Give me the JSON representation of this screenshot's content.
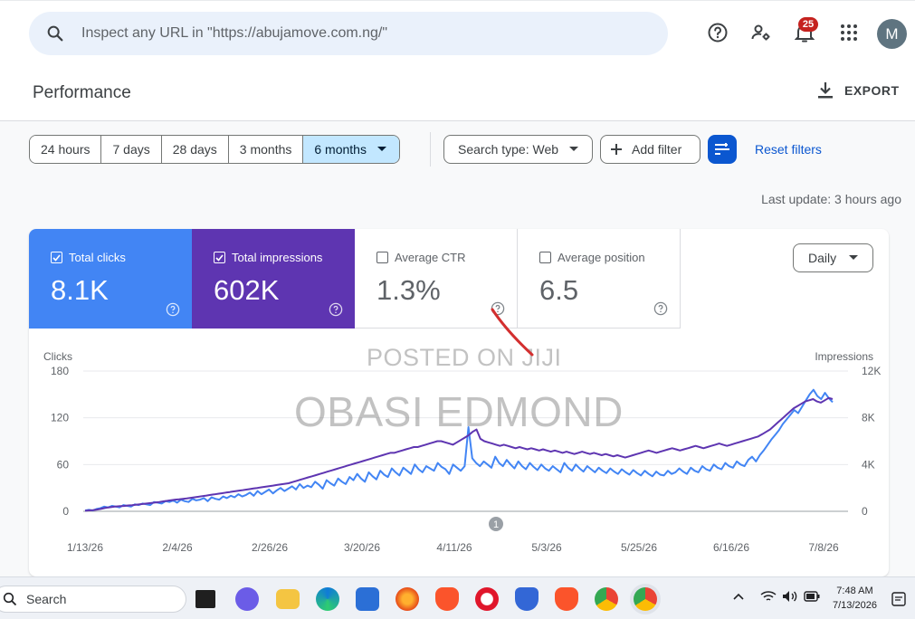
{
  "search": {
    "placeholder": "Inspect any URL in \"https://abujamove.com.ng/\""
  },
  "header": {
    "notification_count": "25",
    "avatar_letter": "M"
  },
  "page": {
    "title": "Performance",
    "export_label": "EXPORT"
  },
  "filters": {
    "date_ranges": [
      "24 hours",
      "7 days",
      "28 days",
      "3 months",
      "6 months"
    ],
    "active_range": "6 months",
    "search_type": "Search type: Web",
    "add_filter": "Add filter",
    "reset": "Reset filters",
    "last_update": "Last update: 3 hours ago"
  },
  "metrics": {
    "clicks": {
      "label": "Total clicks",
      "value": "8.1K",
      "checked": true
    },
    "impressions": {
      "label": "Total impressions",
      "value": "602K",
      "checked": true
    },
    "ctr": {
      "label": "Average CTR",
      "value": "1.3%",
      "checked": false
    },
    "position": {
      "label": "Average position",
      "value": "6.5",
      "checked": false
    }
  },
  "granularity": "Daily",
  "watermark": {
    "line1": "POSTED ON JIJI",
    "line2": "OBASI EDMOND"
  },
  "colors": {
    "clicks": "#4285f4",
    "impressions": "#5e35b1",
    "accent": "#0b57d0"
  },
  "chart_data": {
    "type": "line",
    "ylabel_left": "Clicks",
    "ylabel_right": "Impressions",
    "y_left_ticks": [
      "180",
      "120",
      "60",
      "0"
    ],
    "y_right_ticks": [
      "12K",
      "8K",
      "4K",
      "0"
    ],
    "y_left_range": [
      0,
      180
    ],
    "y_right_range": [
      0,
      12000
    ],
    "x_ticks": [
      "1/13/26",
      "2/4/26",
      "2/26/26",
      "3/20/26",
      "4/11/26",
      "5/3/26",
      "5/25/26",
      "6/16/26",
      "7/8/26"
    ],
    "annotation": "1",
    "grid": true,
    "series": [
      {
        "name": "Clicks",
        "axis": "left",
        "values": [
          1,
          2,
          1,
          3,
          4,
          6,
          5,
          7,
          6,
          5,
          8,
          7,
          6,
          9,
          8,
          10,
          9,
          8,
          12,
          11,
          10,
          13,
          12,
          14,
          11,
          15,
          13,
          12,
          16,
          14,
          15,
          17,
          13,
          18,
          16,
          15,
          19,
          17,
          20,
          18,
          22,
          19,
          21,
          24,
          20,
          26,
          22,
          25,
          28,
          23,
          27,
          30,
          26,
          29,
          32,
          28,
          35,
          30,
          33,
          31,
          38,
          34,
          29,
          40,
          36,
          33,
          42,
          38,
          35,
          44,
          40,
          48,
          42,
          38,
          50,
          45,
          41,
          52,
          47,
          44,
          55,
          50,
          46,
          56,
          52,
          48,
          60,
          54,
          50,
          58,
          55,
          52,
          62,
          57,
          54,
          48,
          60,
          56,
          52,
          58,
          108,
          68,
          62,
          58,
          64,
          60,
          56,
          70,
          62,
          58,
          66,
          60,
          55,
          64,
          58,
          54,
          62,
          57,
          53,
          60,
          55,
          52,
          58,
          54,
          50,
          62,
          56,
          52,
          60,
          55,
          51,
          58,
          54,
          50,
          56,
          52,
          49,
          55,
          51,
          48,
          54,
          50,
          47,
          53,
          49,
          46,
          52,
          48,
          45,
          51,
          47,
          46,
          52,
          48,
          50,
          55,
          51,
          48,
          56,
          52,
          50,
          58,
          54,
          52,
          60,
          56,
          54,
          62,
          58,
          56,
          64,
          60,
          58,
          66,
          70,
          64,
          72,
          78,
          85,
          92,
          98,
          104,
          112,
          118,
          124,
          130,
          126,
          134,
          142,
          150,
          156,
          148,
          144,
          152,
          145,
          140
        ]
      },
      {
        "name": "Impressions",
        "axis": "right",
        "values": [
          50,
          80,
          100,
          150,
          200,
          280,
          330,
          380,
          420,
          440,
          460,
          500,
          520,
          560,
          600,
          640,
          680,
          720,
          760,
          800,
          850,
          900,
          950,
          1000,
          1020,
          1060,
          1100,
          1150,
          1200,
          1250,
          1300,
          1350,
          1400,
          1450,
          1500,
          1550,
          1600,
          1650,
          1700,
          1750,
          1800,
          1850,
          1900,
          1950,
          2000,
          2050,
          2100,
          2150,
          2200,
          2250,
          2300,
          2350,
          2400,
          2500,
          2600,
          2700,
          2800,
          2900,
          3000,
          3100,
          3200,
          3300,
          3400,
          3500,
          3600,
          3700,
          3800,
          3900,
          4000,
          4100,
          4200,
          4300,
          4400,
          4500,
          4600,
          4700,
          4800,
          4900,
          5000,
          5000,
          5100,
          5200,
          5300,
          5400,
          5500,
          5500,
          5600,
          5700,
          5800,
          5900,
          6000,
          6000,
          5900,
          5800,
          5700,
          5900,
          6100,
          6300,
          6500,
          6800,
          7000,
          6200,
          6000,
          5900,
          5800,
          5700,
          5600,
          5700,
          5600,
          5500,
          5400,
          5500,
          5400,
          5300,
          5400,
          5300,
          5200,
          5300,
          5200,
          5100,
          5200,
          5100,
          5000,
          5100,
          5000,
          4900,
          5000,
          5100,
          5000,
          4900,
          5000,
          4900,
          4800,
          4900,
          4800,
          4700,
          4800,
          4700,
          4600,
          4700,
          4800,
          4900,
          5000,
          5100,
          5200,
          5100,
          5000,
          5100,
          5200,
          5300,
          5400,
          5300,
          5200,
          5300,
          5400,
          5500,
          5600,
          5500,
          5400,
          5500,
          5600,
          5700,
          5800,
          5700,
          5600,
          5700,
          5800,
          5900,
          6000,
          6100,
          6200,
          6300,
          6400,
          6600,
          6800,
          7000,
          7300,
          7600,
          7900,
          8200,
          8500,
          8800,
          9000,
          9200,
          9400,
          9500,
          9600,
          9400,
          9300,
          9500,
          9700,
          9600
        ]
      }
    ]
  },
  "taskbar": {
    "search_label": "Search",
    "time": "7:48 AM",
    "date": "7/13/2026"
  }
}
